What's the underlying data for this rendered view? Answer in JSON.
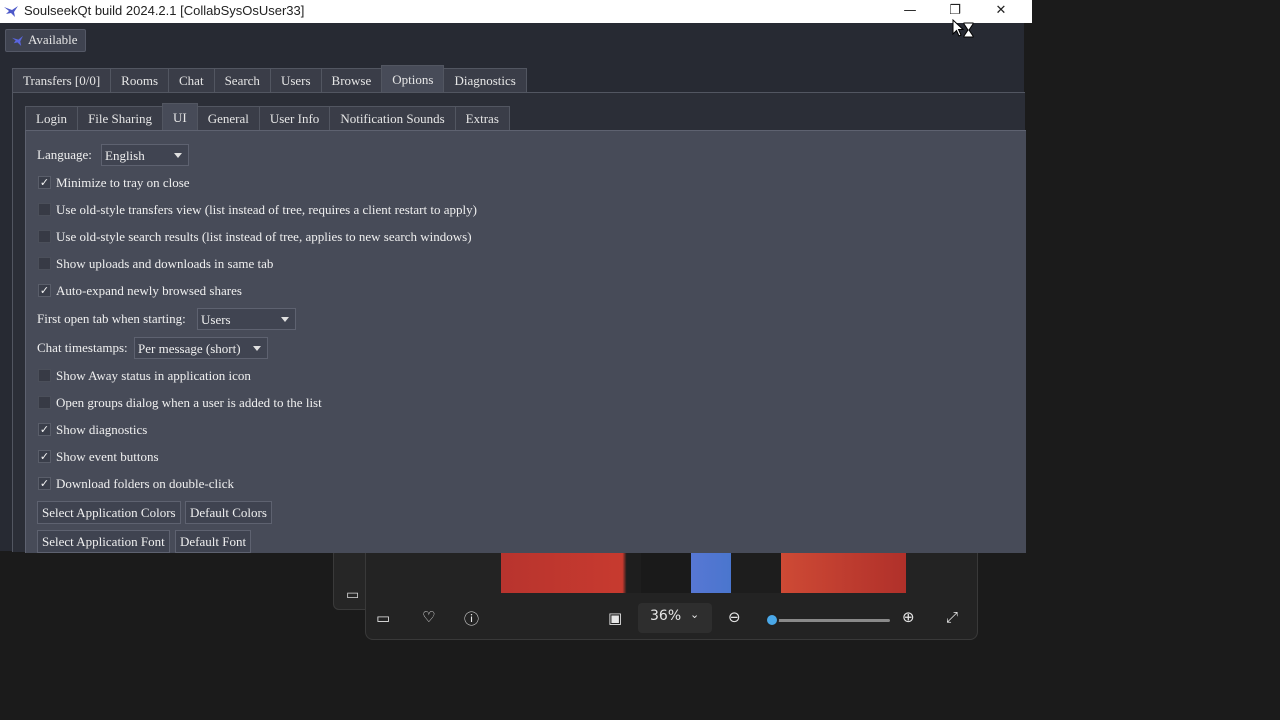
{
  "window": {
    "title": "SoulseekQt build 2024.2.1 [CollabSysOsUser33]",
    "controls": {
      "minimize": "—",
      "restore": "❐",
      "close": "✕"
    }
  },
  "status": {
    "label": "Available"
  },
  "outer_tabs": [
    "Transfers [0/0]",
    "Rooms",
    "Chat",
    "Search",
    "Users",
    "Browse",
    "Options",
    "Diagnostics"
  ],
  "outer_active": "Options",
  "inner_tabs": [
    "Login",
    "File Sharing",
    "UI",
    "General",
    "User Info",
    "Notification Sounds",
    "Extras"
  ],
  "inner_active": "UI",
  "ui_options": {
    "language_label": "Language:",
    "language_value": "English",
    "minimize_to_tray": {
      "label": "Minimize to tray on close",
      "checked": true
    },
    "old_style_transfers": {
      "label": "Use old-style transfers view (list instead of tree, requires a client restart to apply)",
      "checked": false
    },
    "old_style_search": {
      "label": "Use old-style search results (list instead of tree, applies to new search windows)",
      "checked": false
    },
    "same_tab": {
      "label": "Show uploads and downloads in same tab",
      "checked": false
    },
    "auto_expand": {
      "label": "Auto-expand newly browsed shares",
      "checked": true
    },
    "first_tab_label": "First open tab when starting:",
    "first_tab_value": "Users",
    "timestamps_label": "Chat timestamps:",
    "timestamps_value": "Per message (short)",
    "away_status": {
      "label": "Show Away status in application icon",
      "checked": false
    },
    "groups_dialog": {
      "label": "Open groups dialog when a user is added to the list",
      "checked": false
    },
    "show_diagnostics": {
      "label": "Show diagnostics",
      "checked": true
    },
    "show_event_buttons": {
      "label": "Show event buttons",
      "checked": true
    },
    "download_folders": {
      "label": "Download folders on double-click",
      "checked": true
    },
    "select_colors_button": "Select Application Colors",
    "default_colors_button": "Default Colors",
    "select_font_button": "Select Application Font",
    "default_font_button": "Default Font"
  },
  "photos_viewer": {
    "zoom": "36%",
    "zoom_fraction": 0.05,
    "colors": {
      "accent": "#4aa8e8"
    }
  },
  "colors": {
    "window_bg": "#272a33",
    "page_bg": "#474b58",
    "titlebar_bg": "#ffffff"
  }
}
